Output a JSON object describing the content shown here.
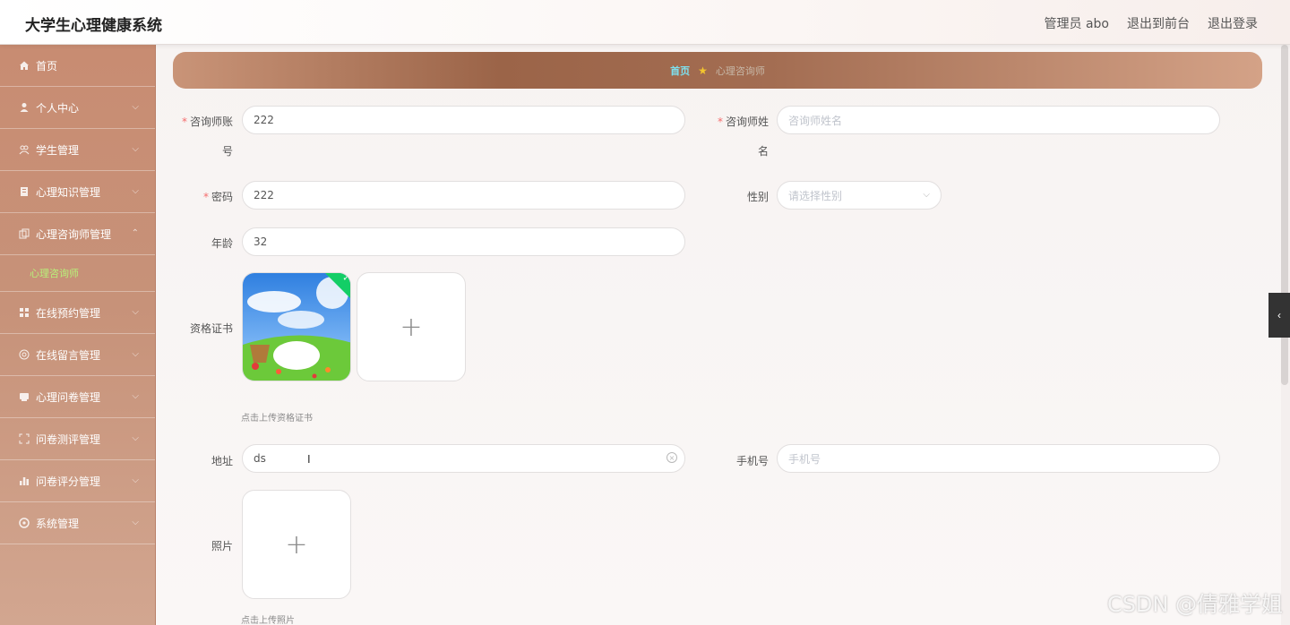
{
  "header": {
    "app_title": "大学生心理健康系统",
    "admin_label": "管理员 abo",
    "back_to_front": "退出到前台",
    "logout": "退出登录"
  },
  "sidebar": {
    "items": [
      {
        "label": "首页",
        "icon": "home-icon"
      },
      {
        "label": "个人中心",
        "icon": "user-icon"
      },
      {
        "label": "学生管理",
        "icon": "users-icon"
      },
      {
        "label": "心理知识管理",
        "icon": "book-icon"
      },
      {
        "label": "心理咨询师管理",
        "icon": "copy-icon"
      },
      {
        "label": "在线预约管理",
        "icon": "grid-icon"
      },
      {
        "label": "在线留言管理",
        "icon": "chat-icon"
      },
      {
        "label": "心理问卷管理",
        "icon": "clipboard-icon"
      },
      {
        "label": "问卷测评管理",
        "icon": "expand-icon"
      },
      {
        "label": "问卷评分管理",
        "icon": "chart-icon"
      },
      {
        "label": "系统管理",
        "icon": "settings-icon"
      }
    ],
    "sub_item": "心理咨询师",
    "active_sub_color": "#b8f07a"
  },
  "breadcrumb": {
    "home": "首页",
    "current": "心理咨询师"
  },
  "form": {
    "account_label_1": "咨询师账",
    "account_label_2": "号",
    "account_value": "222",
    "name_label_1": "咨询师姓",
    "name_label_2": "名",
    "name_placeholder": "咨询师姓名",
    "password_label": "密码",
    "password_value": "222",
    "gender_label": "性别",
    "gender_placeholder": "请选择性别",
    "age_label": "年龄",
    "age_value": "32",
    "cert_label": "资格证书",
    "cert_hint": "点击上传资格证书",
    "address_label": "地址",
    "address_value": "ds",
    "phone_label": "手机号",
    "phone_placeholder": "手机号",
    "photo_label": "照片",
    "photo_hint": "点击上传照片"
  },
  "watermark": "CSDN @倩雅学姐"
}
